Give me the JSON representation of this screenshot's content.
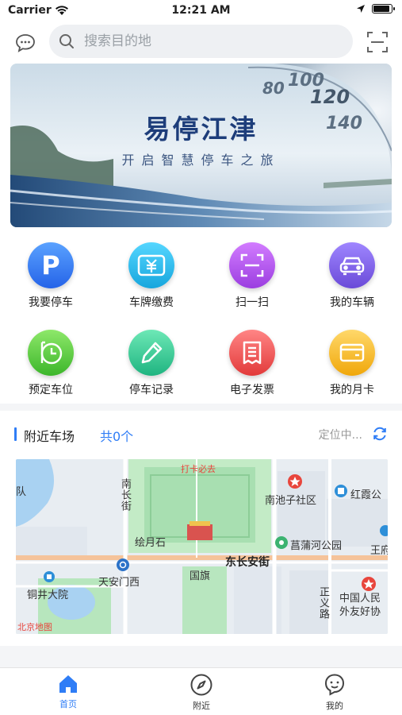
{
  "status": {
    "carrier": "Carrier",
    "time": "12:21 AM",
    "battery_level": 0.9
  },
  "search": {
    "placeholder": "搜索目的地"
  },
  "banner": {
    "title": "易停江津",
    "subtitle": "开启智慧停车之旅",
    "speedo_numbers": [
      "80",
      "100",
      "120",
      "140"
    ]
  },
  "menu": [
    {
      "label": "我要停车",
      "icon": "parking-p-icon",
      "color": "#3478f6"
    },
    {
      "label": "车牌缴费",
      "icon": "yuan-payment-icon",
      "color": "#28b9e6"
    },
    {
      "label": "扫一扫",
      "icon": "scan-icon",
      "color": "#b04de6"
    },
    {
      "label": "我的车辆",
      "icon": "car-icon",
      "color": "#7a5ce6"
    },
    {
      "label": "预定车位",
      "icon": "reserve-parking-icon",
      "color": "#52c93c"
    },
    {
      "label": "停车记录",
      "icon": "pencil-icon",
      "color": "#2ec48f"
    },
    {
      "label": "电子发票",
      "icon": "receipt-icon",
      "color": "#ef4c4c"
    },
    {
      "label": "我的月卡",
      "icon": "card-icon",
      "color": "#f2b318"
    }
  ],
  "nearby": {
    "title": "附近车场",
    "count": "共0个",
    "locating": "定位中..."
  },
  "map": {
    "labels": {
      "daka": "打卡必去",
      "nanchang": "南长街",
      "huiyueshi": "绘月石",
      "tiananmen_west": "天安门西",
      "guoqi": "国旗",
      "dongchangan": "东长安街",
      "tongjing": "铜井大院",
      "nanchizi": "南池子社区",
      "changpu": "菖蒲河公园",
      "hongxia": "红霞公",
      "wangfu": "王府",
      "zhengyi": "正义路",
      "youxie": "中国人民外友好协",
      "dui": "队",
      "logo": "北京地图"
    }
  },
  "tabs": [
    {
      "label": "首页",
      "icon": "home-icon",
      "active": true
    },
    {
      "label": "附近",
      "icon": "compass-icon",
      "active": false
    },
    {
      "label": "我的",
      "icon": "profile-icon",
      "active": false
    }
  ],
  "colors": {
    "accent": "#2f7df6",
    "background": "#f4f5f7"
  }
}
